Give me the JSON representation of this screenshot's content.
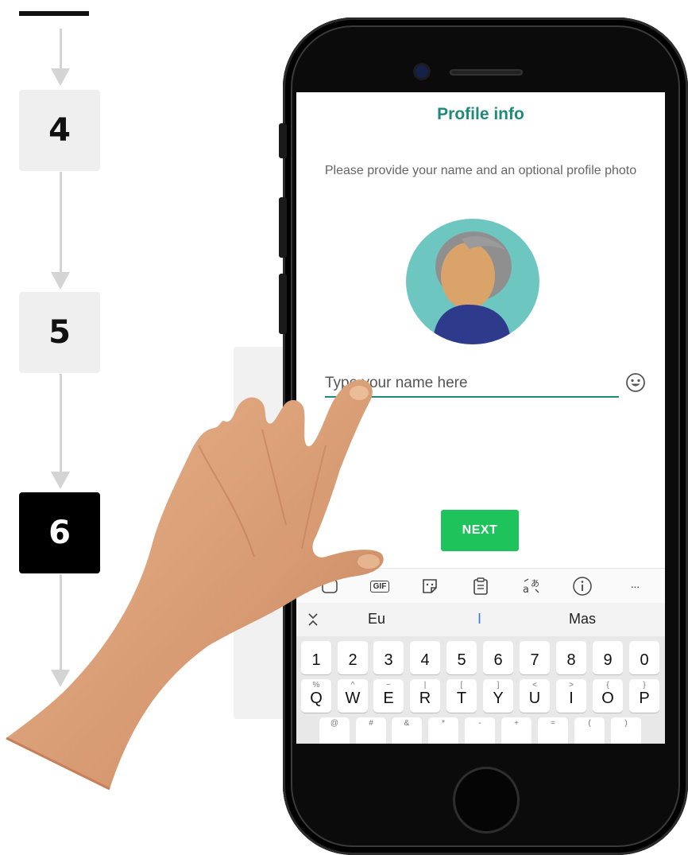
{
  "steps": [
    {
      "label": "4",
      "active": false
    },
    {
      "label": "5",
      "active": false
    },
    {
      "label": "6",
      "active": true
    }
  ],
  "screen": {
    "title": "Profile info",
    "subtitle": "Please provide your name and an optional profile photo",
    "name_input": {
      "placeholder": "Type your name here",
      "value": ""
    },
    "next_label": "NEXT"
  },
  "keyboard": {
    "toolbar": {
      "gif": "GIF",
      "more": "···"
    },
    "suggestions": [
      "Eu",
      "I",
      "Mas"
    ],
    "number_row": [
      "1",
      "2",
      "3",
      "4",
      "5",
      "6",
      "7",
      "8",
      "9",
      "0"
    ],
    "letter_row": [
      {
        "key": "Q",
        "alt": "%"
      },
      {
        "key": "W",
        "alt": "^"
      },
      {
        "key": "E",
        "alt": "~"
      },
      {
        "key": "R",
        "alt": "|"
      },
      {
        "key": "T",
        "alt": "["
      },
      {
        "key": "Y",
        "alt": "]"
      },
      {
        "key": "U",
        "alt": "<"
      },
      {
        "key": "I",
        "alt": ">"
      },
      {
        "key": "O",
        "alt": "{"
      },
      {
        "key": "P",
        "alt": "}"
      }
    ],
    "partial_row_alts": [
      "@",
      "#",
      "&",
      "*",
      "-",
      "+",
      "=",
      "(",
      ")"
    ]
  },
  "colors": {
    "accent": "#1f8a7a",
    "next_button": "#1fc35c",
    "avatar_bg": "#6ec6c1",
    "active_step": "#000000"
  }
}
